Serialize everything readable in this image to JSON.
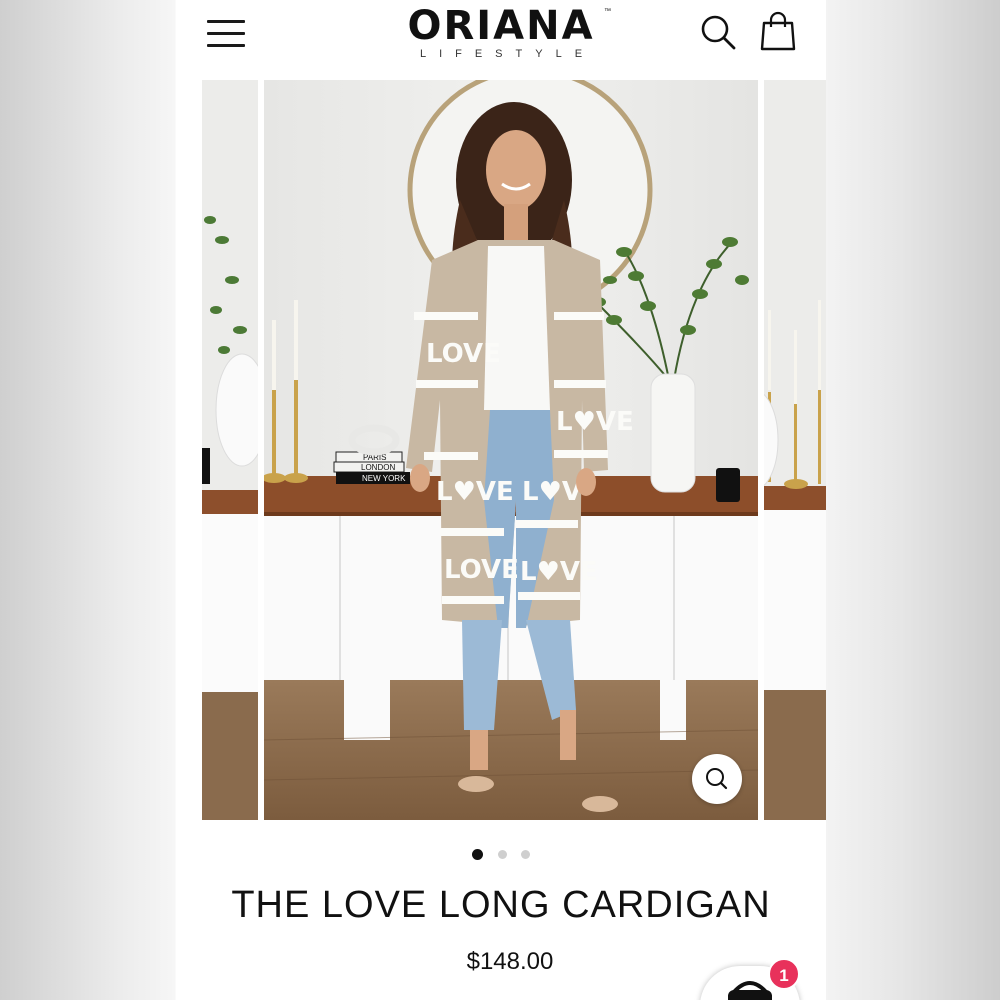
{
  "header": {
    "menu_icon": "hamburger-menu-icon",
    "brand_name": "ORIANA",
    "brand_trademark": "™",
    "brand_tagline": "LIFESTYLE",
    "search_icon": "search-icon",
    "bag_icon": "shopping-bag-icon"
  },
  "gallery": {
    "slides": [
      "previous-slide",
      "current-slide",
      "next-slide"
    ],
    "books": [
      "PARIS",
      "LONDON",
      "NEW YORK"
    ],
    "zoom_icon": "zoom-magnifier-icon",
    "dots": [
      {
        "active": true
      },
      {
        "active": false
      },
      {
        "active": false
      }
    ]
  },
  "product": {
    "title": "THE LOVE LONG CARDIGAN",
    "price": "$148.00"
  },
  "cart": {
    "icon": "cart-icon",
    "badge_count": "1",
    "badge_color": "#e8315b"
  },
  "colors": {
    "text": "#111111",
    "cardigan": "#c9b9a5",
    "wall": "#ececea",
    "floor": "#8a6a4a"
  }
}
